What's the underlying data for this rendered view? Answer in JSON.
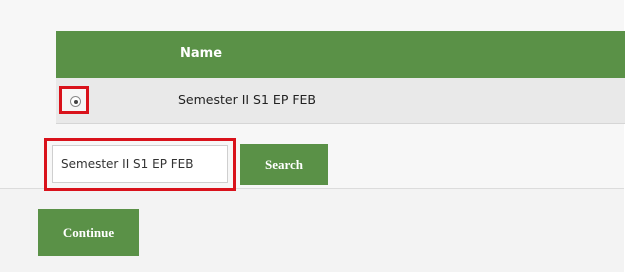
{
  "table": {
    "header_name": "Name",
    "rows": [
      {
        "label": "Semester II S1 EP FEB",
        "selected": true
      }
    ]
  },
  "search": {
    "value": "Semester II S1 EP FEB",
    "button_label": "Search"
  },
  "footer": {
    "continue_label": "Continue"
  },
  "colors": {
    "accent_green": "#5a9147",
    "highlight_red": "#d9121b"
  }
}
